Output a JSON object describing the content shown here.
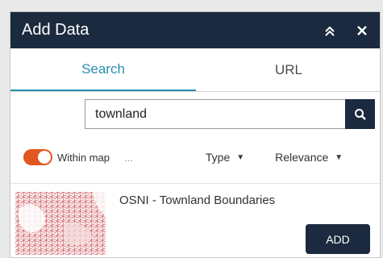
{
  "panel": {
    "title": "Add Data",
    "collapse_icon": "double-chevron-up-icon",
    "close_icon": "close-icon"
  },
  "tabs": [
    {
      "label": "Search",
      "active": true
    },
    {
      "label": "URL",
      "active": false
    }
  ],
  "search": {
    "value": "townland",
    "button_icon": "search-icon"
  },
  "filters": {
    "within_map": {
      "label": "Within map",
      "on": true
    },
    "more_label": "...",
    "type_label": "Type",
    "sort_label": "Relevance"
  },
  "results": [
    {
      "title": "OSNI - Townland Boundaries",
      "add_label": "ADD"
    }
  ],
  "colors": {
    "header": "#1b2a3e",
    "accent": "#2a8fb0",
    "toggle": "#e2561f"
  }
}
